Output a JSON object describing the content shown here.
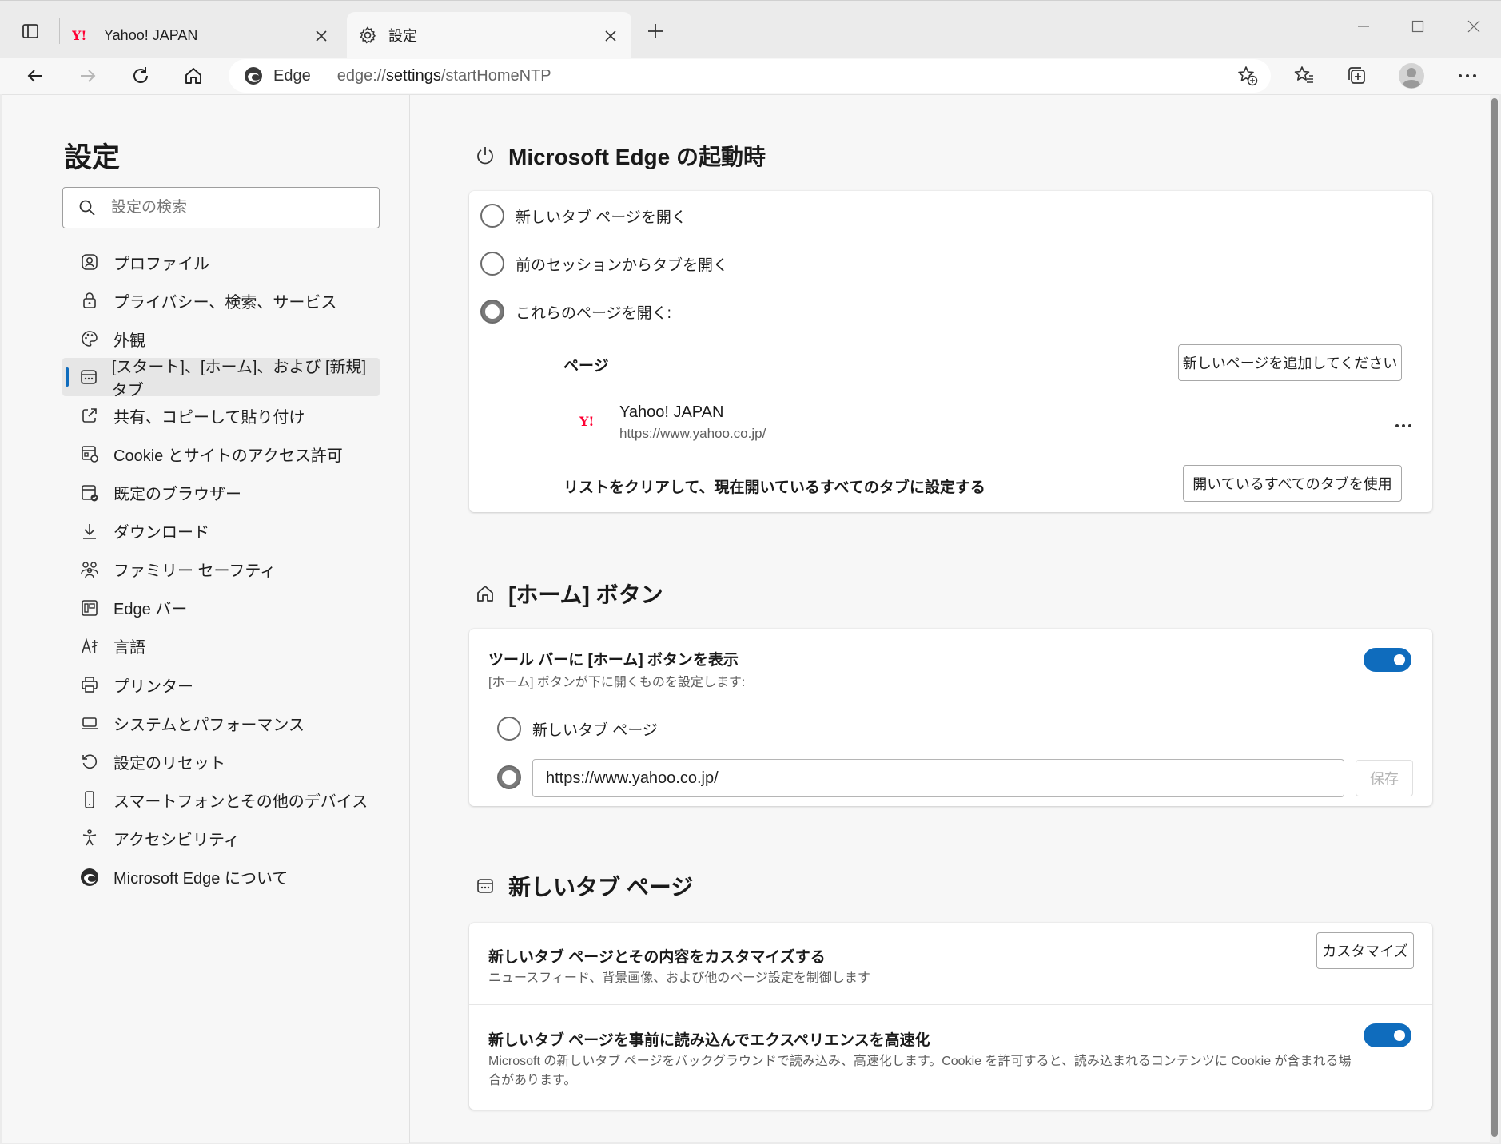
{
  "tabs": [
    {
      "title": "Yahoo! JAPAN",
      "icon": "yahoo-favicon"
    },
    {
      "title": "設定",
      "icon": "gear-icon"
    }
  ],
  "toolbar": {
    "address_brand": "Edge",
    "address_scheme": "edge://",
    "address_path": "settings",
    "address_rest": "/startHomeNTP"
  },
  "sidebar": {
    "title": "設定",
    "search_placeholder": "設定の検索",
    "items": [
      {
        "label": "プロファイル",
        "icon": "profile-icon"
      },
      {
        "label": "プライバシー、検索、サービス",
        "icon": "lock-icon"
      },
      {
        "label": "外観",
        "icon": "palette-icon"
      },
      {
        "label": "[スタート]、[ホーム]、および [新規] タブ",
        "icon": "home-newtab-icon",
        "active": true
      },
      {
        "label": "共有、コピーして貼り付け",
        "icon": "share-icon"
      },
      {
        "label": "Cookie とサイトのアクセス許可",
        "icon": "cookie-permissions-icon"
      },
      {
        "label": "既定のブラウザー",
        "icon": "default-browser-icon"
      },
      {
        "label": "ダウンロード",
        "icon": "download-icon"
      },
      {
        "label": "ファミリー セーフティ",
        "icon": "family-icon"
      },
      {
        "label": "Edge バー",
        "icon": "edge-bar-icon"
      },
      {
        "label": "言語",
        "icon": "language-icon"
      },
      {
        "label": "プリンター",
        "icon": "printer-icon"
      },
      {
        "label": "システムとパフォーマンス",
        "icon": "laptop-icon"
      },
      {
        "label": "設定のリセット",
        "icon": "reset-icon"
      },
      {
        "label": "スマートフォンとその他のデバイス",
        "icon": "phone-icon"
      },
      {
        "label": "アクセシビリティ",
        "icon": "accessibility-icon"
      },
      {
        "label": "Microsoft Edge について",
        "icon": "edge-logo-icon"
      }
    ]
  },
  "startup": {
    "heading": "Microsoft Edge の起動時",
    "option_newtab": "新しいタブ ページを開く",
    "option_previous": "前のセッションからタブを開く",
    "option_pages": "これらのページを開く:",
    "selected": "option_pages",
    "pages_label": "ページ",
    "add_page_button": "新しいページを追加してください",
    "page_title": "Yahoo! JAPAN",
    "page_url": "https://www.yahoo.co.jp/",
    "more_label": "…",
    "clear_text": "リストをクリアして、現在開いているすべてのタブに設定する",
    "use_all_tabs_button": "開いているすべてのタブを使用"
  },
  "home": {
    "heading": "[ホーム] ボタン",
    "toggle_title": "ツール バーに [ホーム] ボタンを表示",
    "toggle_desc": "[ホーム] ボタンが下に開くものを設定します:",
    "toggle_on": true,
    "option_newtab": "新しいタブ ページ",
    "url_value": "https://www.yahoo.co.jp/",
    "selected": "url",
    "save_button": "保存"
  },
  "newtab": {
    "heading": "新しいタブ ページ",
    "customize_title": "新しいタブ ページとその内容をカスタマイズする",
    "customize_desc": "ニュースフィード、背景画像、および他のページ設定を制御します",
    "customize_button": "カスタマイズ",
    "preload_title": "新しいタブ ページを事前に読み込んでエクスペリエンスを高速化",
    "preload_desc": "Microsoft の新しいタブ ページをバックグラウンドで読み込み、高速化します。Cookie を許可すると、読み込まれるコンテンツに Cookie が含まれる場合があります。",
    "preload_on": true
  },
  "colors": {
    "accent": "#0f6cbd",
    "yahoo_red": "#ff0033"
  }
}
